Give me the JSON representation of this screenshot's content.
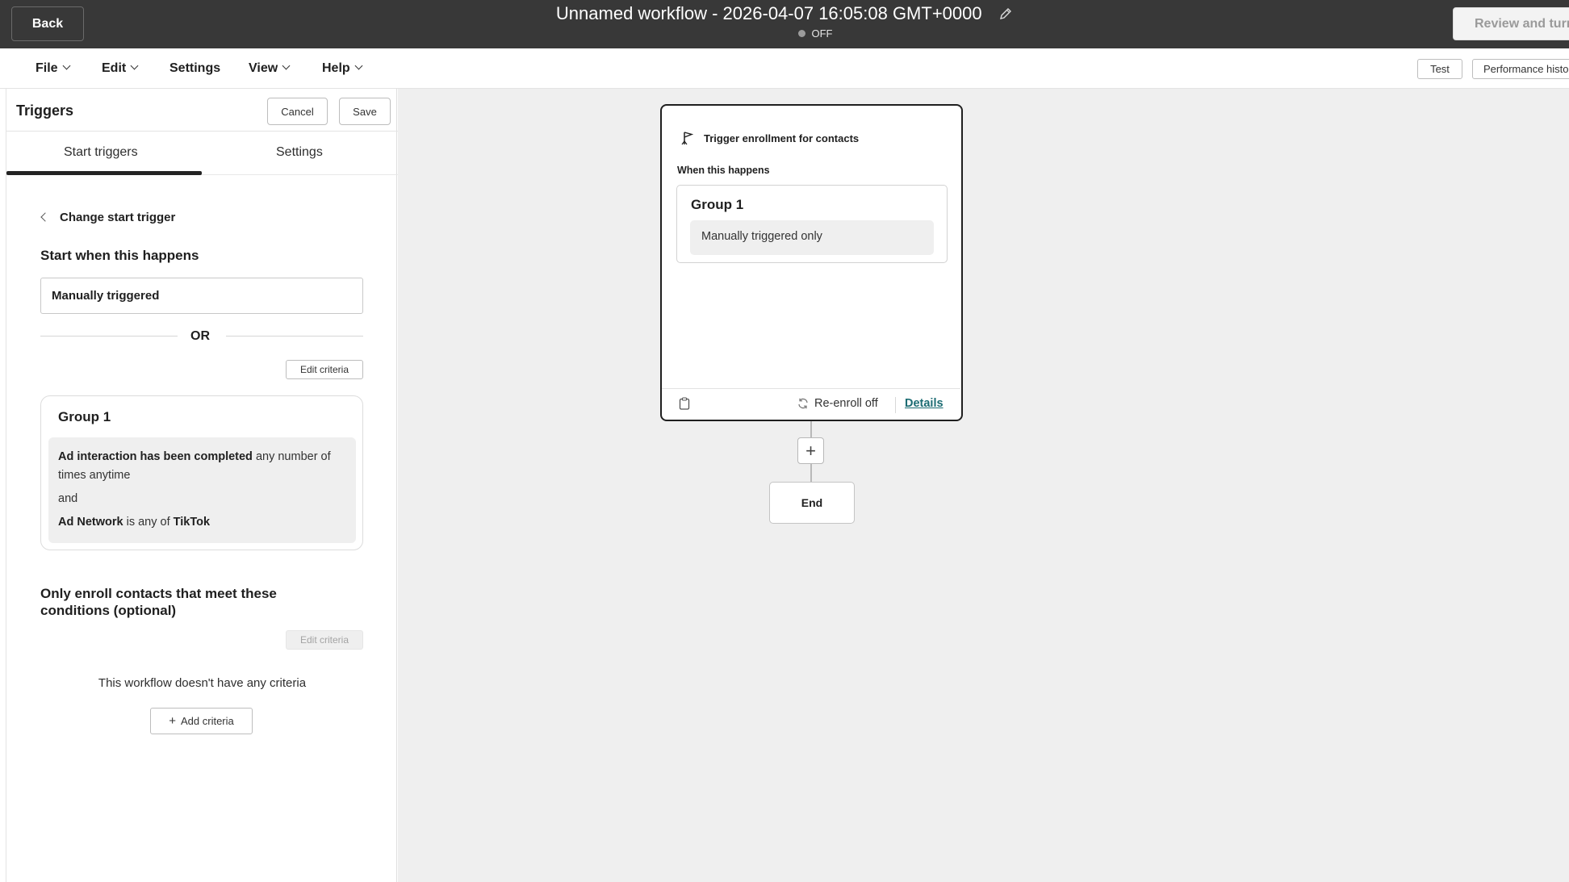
{
  "header": {
    "back_label": "Back",
    "workflow_title": "Unnamed workflow - 2026-04-07 16:05:08 GMT+0000",
    "status": "OFF",
    "review_label": "Review and turn"
  },
  "menubar": {
    "items": [
      "File",
      "Edit",
      "Settings",
      "View",
      "Help"
    ],
    "test_label": "Test",
    "performance_label": "Performance histo"
  },
  "panel": {
    "title": "Triggers",
    "cancel_label": "Cancel",
    "save_label": "Save",
    "tabs": [
      "Start triggers",
      "Settings"
    ],
    "change_start_trigger": "Change start trigger",
    "start_when": "Start when this happens",
    "trigger_value": "Manually triggered",
    "or_label": "OR",
    "edit_criteria_label": "Edit criteria",
    "group": {
      "title": "Group 1",
      "line1_bold": "Ad interaction has been completed",
      "line1_rest": " any number of times anytime",
      "and_label": "and",
      "line2_bold": "Ad Network",
      "line2_mid": " is any of ",
      "line2_value": "TikTok"
    },
    "only_enroll": "Only enroll contacts that meet these conditions (optional)",
    "no_criteria": "This workflow doesn't have any criteria",
    "add_criteria_label": "Add criteria"
  },
  "canvas": {
    "card_title": "Trigger enrollment for contacts",
    "when_label": "When this happens",
    "group_title": "Group 1",
    "group_item": "Manually triggered only",
    "reenroll_label": "Re-enroll off",
    "details_label": "Details",
    "plus_label": "+",
    "end_label": "End"
  },
  "colors": {
    "topbar": "#383838",
    "canvas_bg": "#efefef",
    "details_link": "#1c6c73"
  }
}
